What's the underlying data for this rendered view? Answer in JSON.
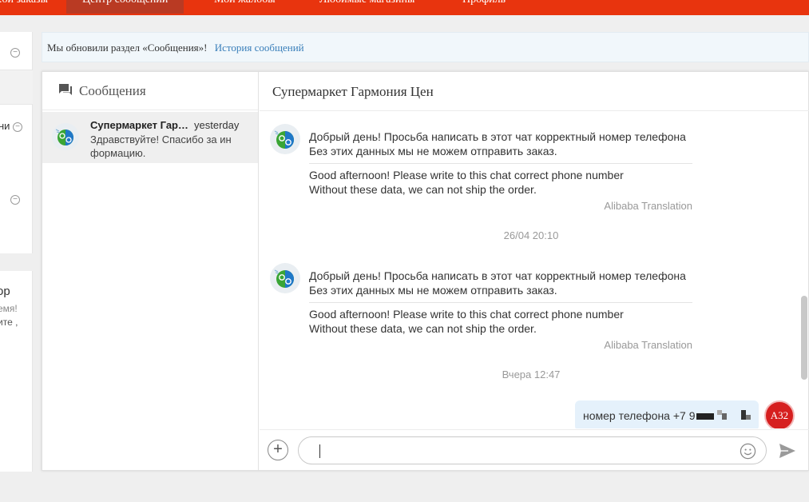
{
  "topnav": {
    "items": [
      {
        "label": "...ои заказы"
      },
      {
        "label": "Центр сообщений"
      },
      {
        "label": "Мои жалобы"
      },
      {
        "label": "Любимые магазины"
      },
      {
        "label": "Профиль"
      }
    ]
  },
  "left": {
    "partial_text_1": "ни",
    "partial_text_2": "ор",
    "partial_text_3": "емя!",
    "partial_text_4": "ите ,"
  },
  "notice": {
    "text": "Мы обновили раздел «Сообщения»!",
    "link": "История сообщений"
  },
  "conversations": {
    "header": "Сообщения",
    "items": [
      {
        "name": "Супермаркет Гармония Цен",
        "time": "yesterday",
        "preview": "Здравствуйте! Спасибо за ин формацию."
      }
    ]
  },
  "chat": {
    "title": "Супермаркет Гармония Цен",
    "messages": [
      {
        "original_1": "Добрый день! Просьба написать в этот чат корректный номер телефона",
        "original_2": "Без этих данных мы не можем отправить заказ.",
        "translation_1": "Good afternoon! Please write to this chat correct phone number",
        "translation_2": "Without these data, we can not ship the order.",
        "translated_by": "Alibaba Translation"
      },
      {
        "original_1": "Добрый день! Просьба написать в этот чат корректный номер телефона",
        "original_2": "Без этих данных мы не можем отправить заказ.",
        "translation_1": "Good afternoon! Please write to this chat correct phone number",
        "translation_2": "Without these data, we can not ship the order.",
        "translated_by": "Alibaba Translation"
      }
    ],
    "timestamps": [
      "26/04 20:10",
      "Вчера 12:47"
    ],
    "my_message": "номер телефона +7 9",
    "my_avatar": "А32"
  },
  "composer": {
    "value": ""
  },
  "colors": {
    "brand": "#e8340e",
    "active_tab": "#b93a23",
    "link": "#3a7fba",
    "my_bubble": "#e5f1fb",
    "avatar_red": "#d61f1f"
  },
  "icons": {
    "list_header": "message-icon",
    "shop_avatar": "shop-logo-icon",
    "add": "plus-icon",
    "emoji": "smile-icon",
    "send": "send-icon"
  }
}
